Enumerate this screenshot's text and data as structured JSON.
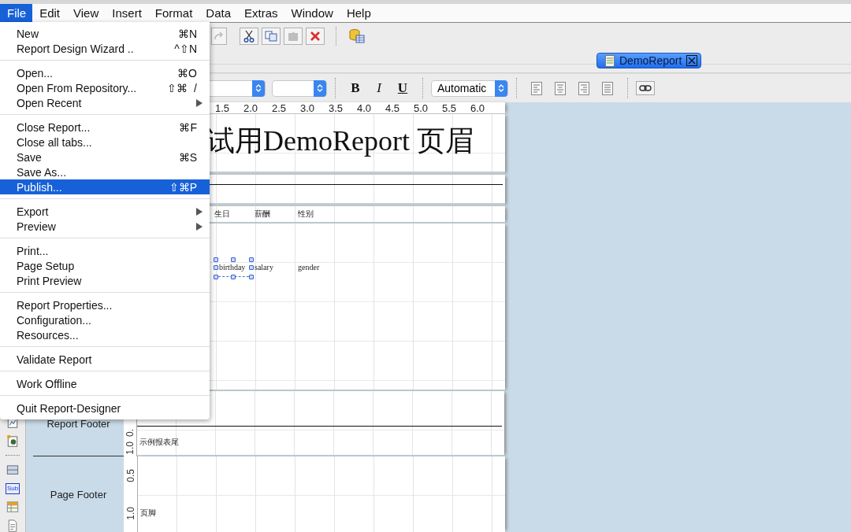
{
  "menubar": [
    {
      "label": "File",
      "selected": true
    },
    {
      "label": "Edit",
      "selected": false
    },
    {
      "label": "View",
      "selected": false
    },
    {
      "label": "Insert",
      "selected": false
    },
    {
      "label": "Format",
      "selected": false
    },
    {
      "label": "Data",
      "selected": false
    },
    {
      "label": "Extras",
      "selected": false
    },
    {
      "label": "Window",
      "selected": false
    },
    {
      "label": "Help",
      "selected": false
    }
  ],
  "file_menu": [
    [
      {
        "label": "New",
        "shortcut": "⌘N",
        "has_submenu": false,
        "selected": false
      },
      {
        "label": "Report Design Wizard ..",
        "shortcut": "^⇧N",
        "has_submenu": false,
        "selected": false
      }
    ],
    [
      {
        "label": "Open...",
        "shortcut": "⌘O",
        "has_submenu": false,
        "selected": false
      },
      {
        "label": "Open From Repository...",
        "shortcut": "⇧⌘  /",
        "has_submenu": false,
        "selected": false
      },
      {
        "label": "Open Recent",
        "has_submenu": true,
        "selected": false
      }
    ],
    [
      {
        "label": "Close Report...",
        "shortcut": "⌘F",
        "has_submenu": false,
        "selected": false
      },
      {
        "label": "Close all tabs...",
        "has_submenu": false,
        "selected": false
      },
      {
        "label": "Save",
        "shortcut": "⌘S",
        "has_submenu": false,
        "selected": false
      },
      {
        "label": "Save As...",
        "has_submenu": false,
        "selected": false
      },
      {
        "label": "Publish...",
        "shortcut": "⇧⌘P",
        "has_submenu": false,
        "selected": true
      }
    ],
    [
      {
        "label": "Export",
        "has_submenu": true,
        "selected": false
      },
      {
        "label": "Preview",
        "has_submenu": true,
        "selected": false
      }
    ],
    [
      {
        "label": "Print...",
        "has_submenu": false,
        "selected": false
      },
      {
        "label": "Page Setup",
        "has_submenu": false,
        "selected": false
      },
      {
        "label": "Print Preview",
        "has_submenu": false,
        "selected": false
      }
    ],
    [
      {
        "label": "Report Properties...",
        "has_submenu": false,
        "selected": false
      },
      {
        "label": "Configuration...",
        "has_submenu": false,
        "selected": false
      },
      {
        "label": "Resources...",
        "has_submenu": false,
        "selected": false
      }
    ],
    [
      {
        "label": "Validate Report",
        "has_submenu": false,
        "selected": false
      }
    ],
    [
      {
        "label": "Work Offline",
        "has_submenu": false,
        "selected": false
      }
    ],
    [
      {
        "label": "Quit Report-Designer",
        "has_submenu": false,
        "selected": false
      }
    ]
  ],
  "toolbar": [
    {
      "kind": "redo",
      "disabled": true
    },
    {
      "kind": "cut",
      "disabled": false
    },
    {
      "kind": "copy",
      "disabled": false
    },
    {
      "kind": "paste",
      "disabled": true
    },
    {
      "kind": "delete",
      "disabled": false
    },
    {
      "kind": "database",
      "disabled": false
    }
  ],
  "tabs": [
    {
      "label": "DemoReport",
      "selected": true
    }
  ],
  "format_bar": {
    "styles": [
      "B",
      "I",
      "U"
    ],
    "foreground": "Automatic",
    "align": [
      {
        "kind": "left"
      },
      {
        "kind": "center"
      },
      {
        "kind": "right"
      },
      {
        "kind": "justify"
      }
    ]
  },
  "palette": [
    {
      "kind": "chart"
    },
    {
      "kind": "image"
    },
    {
      "kind": "band"
    },
    {
      "kind": "subreport",
      "label": "Sub"
    },
    {
      "kind": "table"
    },
    {
      "kind": "document"
    }
  ],
  "ruler": [
    "1.5",
    "2.0",
    "2.5",
    "3.0",
    "3.5",
    "4.0",
    "4.5",
    "5.0",
    "5.5",
    "6.0"
  ],
  "page_header": {
    "title": "试用DemoReport 页眉"
  },
  "column_headers": [
    "生日",
    "薪酬",
    "性别"
  ],
  "details": [
    {
      "field": "birthday",
      "selected": true
    },
    {
      "field": "salary",
      "selected": false
    },
    {
      "field": "gender",
      "selected": false
    }
  ],
  "report_footer": {
    "label": "Report Footer",
    "ruler": [
      "0.",
      "1.0"
    ],
    "text": "示例报表尾"
  },
  "page_footer": {
    "label": "Page Footer",
    "ruler": [
      "0.5",
      "1.0"
    ],
    "text": "页脚"
  }
}
